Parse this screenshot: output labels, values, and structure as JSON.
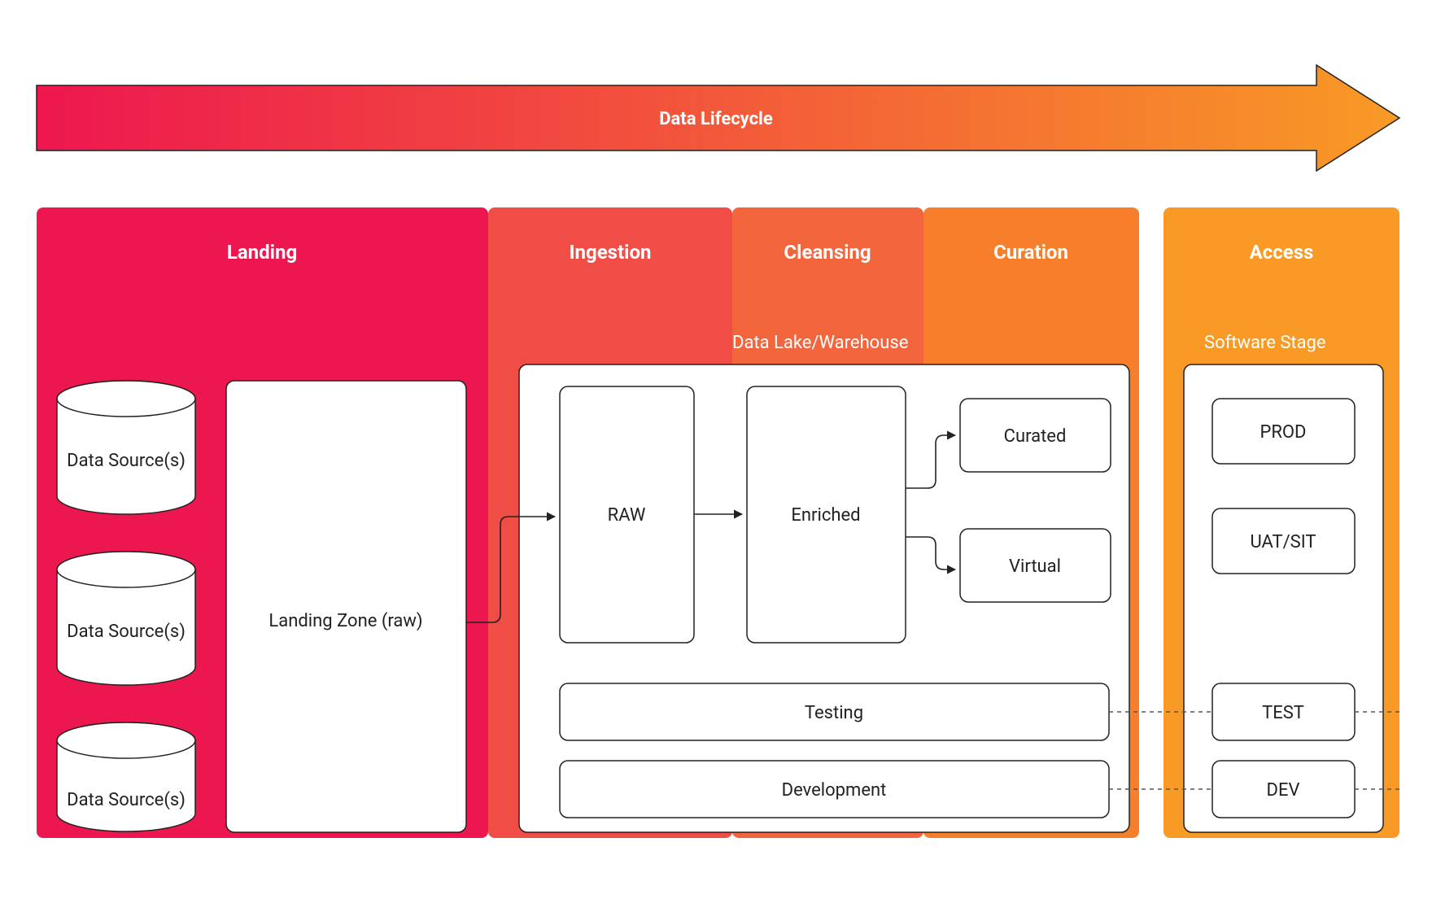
{
  "arrow": {
    "title": "Data Lifecycle"
  },
  "stages": {
    "landing": {
      "title": "Landing",
      "color": "#ED174F"
    },
    "ingestion": {
      "title": "Ingestion",
      "color": "#F04D47"
    },
    "cleansing": {
      "title": "Cleansing",
      "color": "#F2653D"
    },
    "curation": {
      "title": "Curation",
      "color": "#F77F2C"
    },
    "access": {
      "title": "Access",
      "color": "#F89A25"
    }
  },
  "landing": {
    "sources": [
      "Data Source(s)",
      "Data Source(s)",
      "Data Source(s)"
    ],
    "zone": "Landing Zone (raw)"
  },
  "lake": {
    "group_label": "Data Lake/Warehouse",
    "raw": "RAW",
    "enriched": "Enriched",
    "curated": "Curated",
    "virtual": "Virtual",
    "testing": "Testing",
    "development": "Development"
  },
  "software": {
    "group_label": "Software Stage",
    "prod": "PROD",
    "uat": "UAT/SIT",
    "test": "TEST",
    "dev": "DEV"
  },
  "gradient": {
    "from": "#ED174F",
    "to": "#F89A25"
  }
}
